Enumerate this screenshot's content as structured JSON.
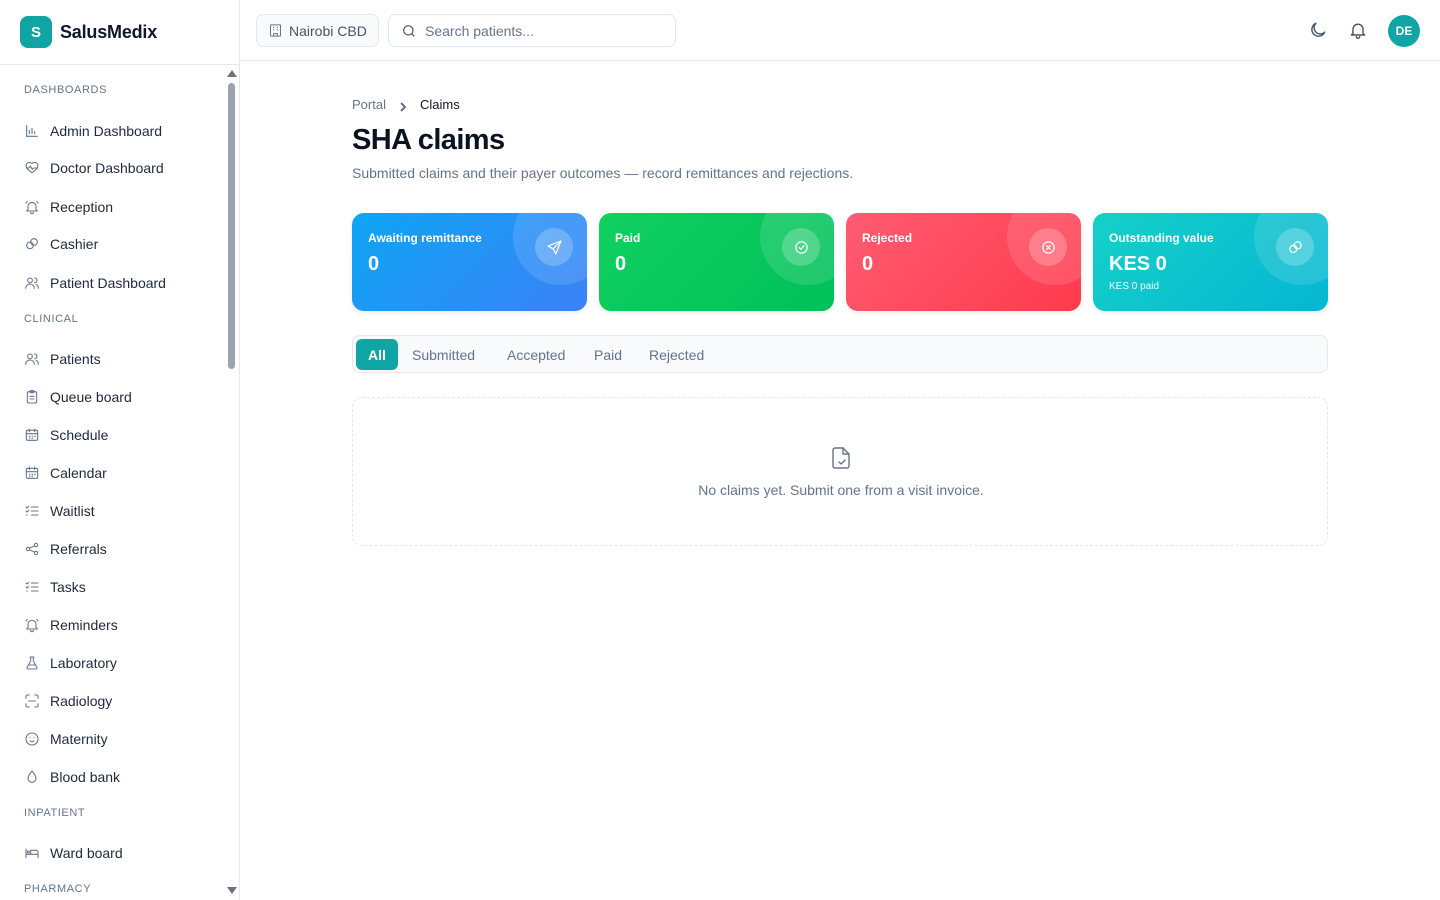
{
  "brand": {
    "logo_letter": "S",
    "name": "SalusMedix"
  },
  "sidebar": {
    "sections": [
      {
        "title": "DASHBOARDS",
        "items": [
          {
            "label": "Admin Dashboard",
            "icon": "bar-chart-icon"
          },
          {
            "label": "Doctor Dashboard",
            "icon": "heart-pulse-icon"
          },
          {
            "label": "Reception",
            "icon": "bell-ring-icon"
          },
          {
            "label": "Cashier",
            "icon": "coins-icon"
          },
          {
            "label": "Patient Dashboard",
            "icon": "users-icon"
          }
        ]
      },
      {
        "title": "CLINICAL",
        "items": [
          {
            "label": "Patients",
            "icon": "users-icon"
          },
          {
            "label": "Queue board",
            "icon": "clipboard-icon"
          },
          {
            "label": "Schedule",
            "icon": "calendar-icon"
          },
          {
            "label": "Calendar",
            "icon": "calendar-icon"
          },
          {
            "label": "Waitlist",
            "icon": "list-checks-icon"
          },
          {
            "label": "Referrals",
            "icon": "share-icon"
          },
          {
            "label": "Tasks",
            "icon": "list-checks-icon"
          },
          {
            "label": "Reminders",
            "icon": "bell-ring-icon"
          },
          {
            "label": "Laboratory",
            "icon": "flask-icon"
          },
          {
            "label": "Radiology",
            "icon": "scan-icon"
          },
          {
            "label": "Maternity",
            "icon": "baby-icon"
          },
          {
            "label": "Blood bank",
            "icon": "droplet-icon"
          }
        ]
      },
      {
        "title": "INPATIENT",
        "items": [
          {
            "label": "Ward board",
            "icon": "bed-icon"
          }
        ]
      },
      {
        "title": "PHARMACY",
        "items": []
      }
    ]
  },
  "header": {
    "branch": "Nairobi CBD",
    "search_placeholder": "Search patients...",
    "avatar_initials": "DE"
  },
  "breadcrumb": {
    "root": "Portal",
    "current": "Claims"
  },
  "page": {
    "title": "SHA claims",
    "subtitle": "Submitted claims and their payer outcomes — record remittances and rejections."
  },
  "cards": [
    {
      "label": "Awaiting remittance",
      "value": "0",
      "sub": "",
      "icon": "send-icon",
      "color_from": "#0ea5f5",
      "color_to": "#3b82f6"
    },
    {
      "label": "Paid",
      "value": "0",
      "sub": "",
      "icon": "check-circle-icon",
      "color_from": "#10d060",
      "color_to": "#00c05a"
    },
    {
      "label": "Rejected",
      "value": "0",
      "sub": "",
      "icon": "x-circle-icon",
      "color_from": "#ff5c72",
      "color_to": "#ff3a4d"
    },
    {
      "label": "Outstanding value",
      "value": "KES 0",
      "sub": "KES 0 paid",
      "icon": "coins-icon",
      "color_from": "#14d0c8",
      "color_to": "#06b6d4"
    }
  ],
  "tabs": [
    {
      "label": "All",
      "active": true
    },
    {
      "label": "Submitted",
      "active": false
    },
    {
      "label": "Accepted",
      "active": false
    },
    {
      "label": "Paid",
      "active": false
    },
    {
      "label": "Rejected",
      "active": false
    }
  ],
  "empty_state": {
    "message": "No claims yet. Submit one from a visit invoice.",
    "icon": "file-check-icon"
  }
}
